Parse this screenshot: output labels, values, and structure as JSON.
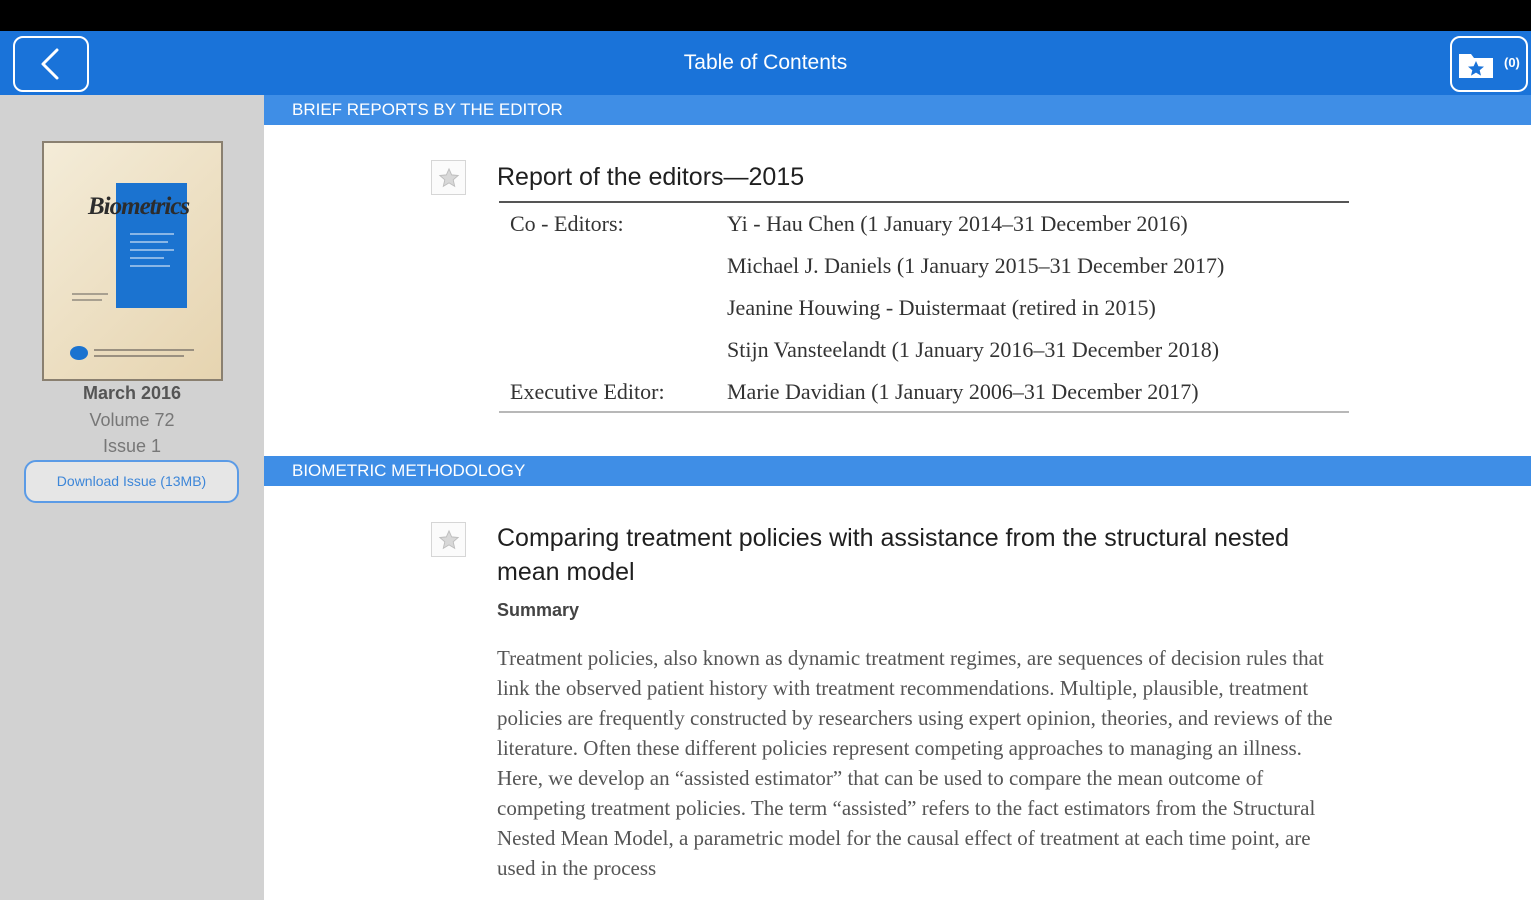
{
  "app_bar": {
    "title": "Table of Contents",
    "saved_count": "(0)"
  },
  "sidebar": {
    "cover_title": "Biometrics",
    "issue_date": "March 2016",
    "volume": "Volume 72",
    "issue": "Issue 1",
    "download_label": "Download Issue (13MB)"
  },
  "sections": [
    {
      "header": "BRIEF REPORTS BY THE EDITOR",
      "article": {
        "title": "Report of the editors—2015",
        "editors": [
          {
            "role": "Co - Editors:",
            "name": "Yi - Hau Chen (1 January 2014–31 December 2016)"
          },
          {
            "role": "",
            "name": "Michael J. Daniels (1 January 2015–31 December 2017)"
          },
          {
            "role": "",
            "name": "Jeanine Houwing - Duistermaat (retired in 2015)"
          },
          {
            "role": "",
            "name": "Stijn Vansteelandt (1 January 2016–31 December 2018)"
          },
          {
            "role": "Executive Editor:",
            "name": "Marie Davidian (1 January 2006–31 December 2017)"
          }
        ]
      }
    },
    {
      "header": "BIOMETRIC METHODOLOGY",
      "article": {
        "title": "Comparing treatment policies with assistance from the structural nested mean model",
        "summary_label": "Summary",
        "abstract": "Treatment policies, also known as dynamic treatment regimes, are sequences of decision rules that link the observed patient history with treatment recommendations. Multiple, plausible, treatment policies are frequently constructed by researchers using expert opinion, theories, and reviews of the literature. Often these different policies represent competing approaches to managing an illness. Here, we develop an “assisted estimator” that can be used to compare the mean outcome of competing treatment policies. The term “assisted” refers to the fact estimators from the Structural Nested Mean Model, a parametric model for the causal effect of treatment at each time point, are used in the process"
      }
    }
  ],
  "colors": {
    "app_bar": "#1a73d9",
    "section_header": "#3f8ee6",
    "sidebar": "#d2d2d2"
  },
  "icons": {
    "back": "chevron-left-icon",
    "saved": "star-folder-icon",
    "favorite": "star-icon"
  }
}
